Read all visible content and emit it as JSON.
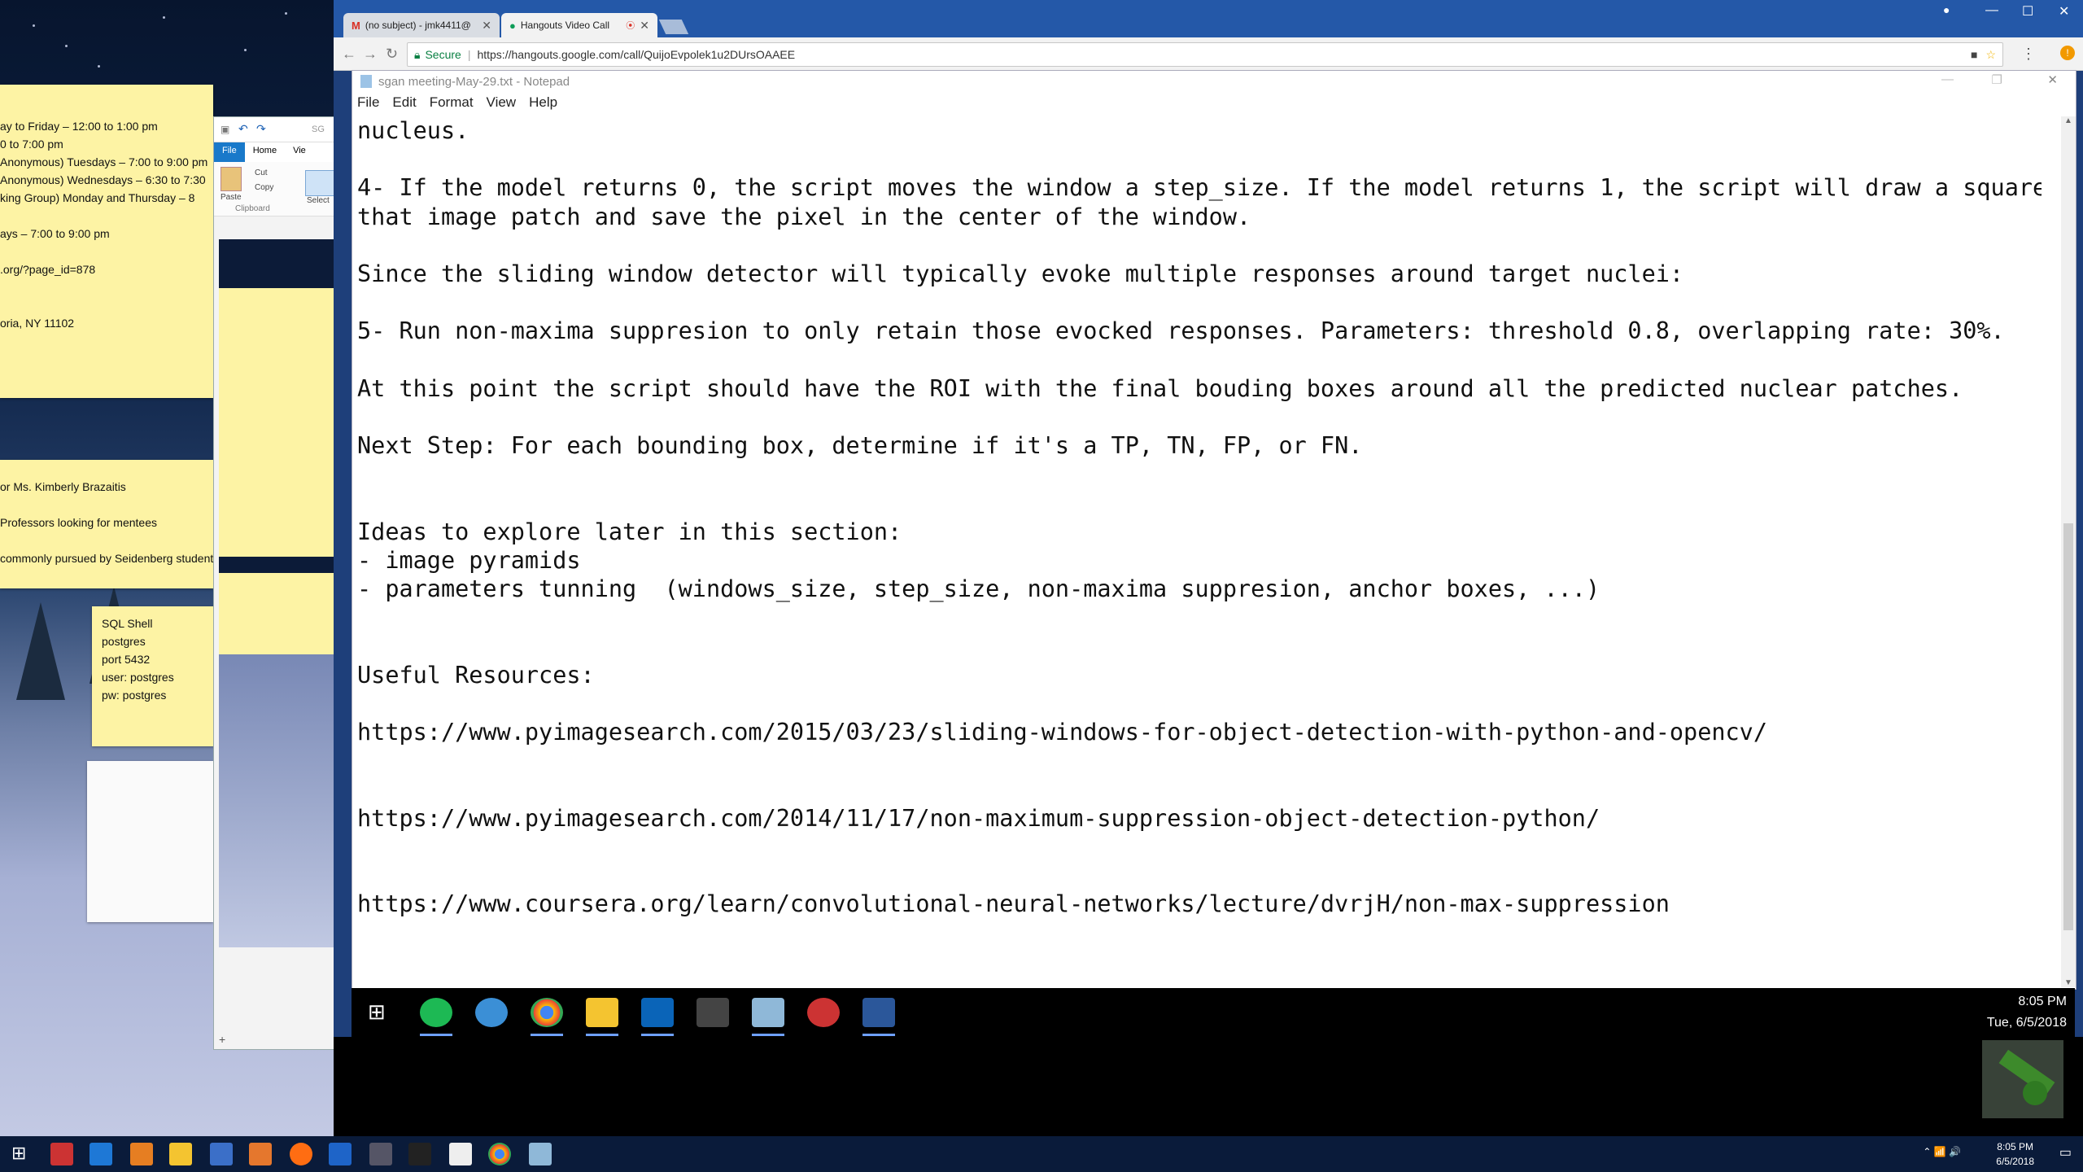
{
  "browser": {
    "tabs": [
      {
        "label": "(no subject) - jmk4411@",
        "icon": "gmail-icon",
        "active": false
      },
      {
        "label": "Hangouts Video Call",
        "icon": "hangouts-icon",
        "active": true
      }
    ],
    "secure_label": "Secure",
    "url": "https://hangouts.google.com/call/QuijoEvpolek1u2DUrsOAAEE"
  },
  "notepad": {
    "title": "sgan meeting-May-29.txt - Notepad",
    "menu": [
      "File",
      "Edit",
      "Format",
      "View",
      "Help"
    ],
    "lines": [
      "nucleus.",
      "",
      "4- If the model returns 0, the script moves the window a step_size. If the model returns 1, the script will draw a square in",
      "that image patch and save the pixel in the center of the window.",
      "",
      "Since the sliding window detector will typically evoke multiple responses around target nuclei:",
      "",
      "5- Run non-maxima suppresion to only retain those evocked responses. Parameters: threshold 0.8, overlapping rate: 30%.",
      "",
      "At this point the script should have the ROI with the final bouding boxes around all the predicted nuclear patches.",
      "",
      "Next Step: For each bounding box, determine if it's a TP, TN, FP, or FN.",
      "",
      "",
      "Ideas to explore later in this section:",
      "- image pyramids",
      "- parameters tunning  (windows_size, step_size, non-maxima suppresion, anchor boxes, ...)",
      "",
      "",
      "Useful Resources:",
      "",
      "https://www.pyimagesearch.com/2015/03/23/sliding-windows-for-object-detection-with-python-and-opencv/",
      "",
      "",
      "https://www.pyimagesearch.com/2014/11/17/non-maximum-suppression-object-detection-python/",
      "",
      "",
      "https://www.coursera.org/learn/convolutional-neural-networks/lecture/dvrjH/non-max-suppression"
    ]
  },
  "sticky_main": {
    "lines": [
      "ay to Friday – 12:00 to 1:00 pm",
      "0 to 7:00 pm",
      "Anonymous)        Tuesdays – 7:00 to 9:00 pm",
      "Anonymous)        Wednesdays – 6:30 to 7:30",
      "king Group)        Monday and Thursday – 8",
      "",
      "ays – 7:00 to 9:00 pm",
      "",
      ".org/?page_id=878",
      "",
      "",
      "oria, NY 11102"
    ]
  },
  "sticky_second": {
    "lines": [
      "or Ms. Kimberly Brazaitis",
      "",
      "Professors looking for mentees",
      "",
      "commonly pursued by Seidenberg students"
    ]
  },
  "sticky_sql": {
    "lines": [
      "SQL Shell",
      "postgres",
      "port 5432",
      "user: postgres",
      "pw: postgres"
    ]
  },
  "explorer": {
    "tabs": [
      "File",
      "Home",
      "Vie"
    ],
    "paste_label": "Paste",
    "cut_label": "Cut",
    "copy_label": "Copy",
    "select_label": "Select",
    "group_label": "Clipboard",
    "partial_title": "SG"
  },
  "call_taskbar": {
    "time": "8:05 PM",
    "date": "Tue, 6/5/2018"
  },
  "host_taskbar": {
    "time": "8:05 PM",
    "date": "6/5/2018"
  }
}
